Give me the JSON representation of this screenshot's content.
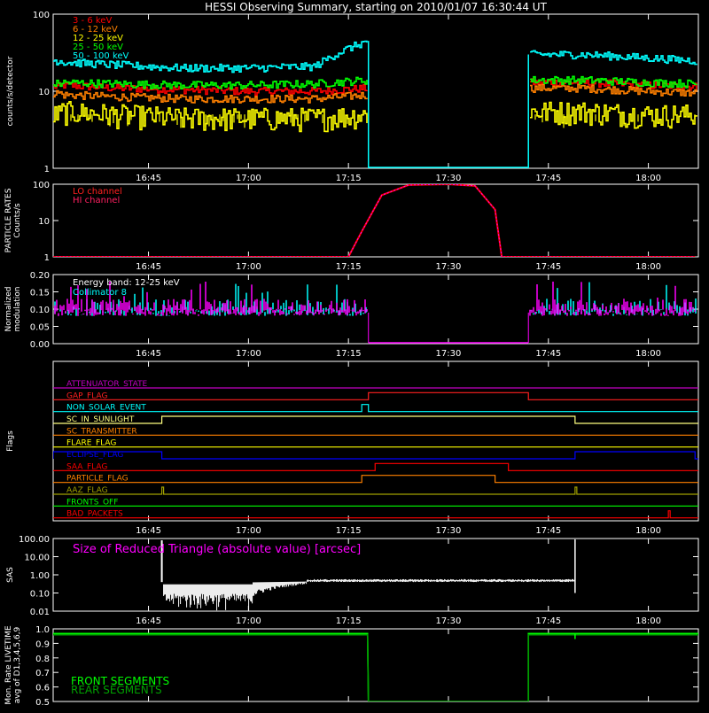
{
  "title": "HESSI Observing Summary, starting on 2010/01/07 16:30:44 UT",
  "time_ticks": [
    "16:45",
    "17:00",
    "17:15",
    "17:30",
    "17:45",
    "18:00"
  ],
  "chart_data": [
    {
      "id": "count-rates",
      "type": "line",
      "ylabel": "counts/s/detector",
      "yscale": "log",
      "ylim": [
        1,
        100
      ],
      "yticks": [
        "1",
        "10",
        "100"
      ],
      "legend_position": "top-left",
      "series": [
        {
          "name": "3 - 6 keV",
          "color": "#ff0000",
          "x": [
            "16:32",
            "16:40",
            "16:50",
            "17:00",
            "17:10",
            "17:18",
            "17:42",
            "17:50",
            "18:00",
            "18:07"
          ],
          "values": [
            12,
            11,
            10.5,
            10,
            10,
            11,
            null,
            13,
            12,
            11.5
          ]
        },
        {
          "name": "6 - 12 keV",
          "color": "#ff8000",
          "x": [
            "16:32",
            "16:40",
            "16:50",
            "17:00",
            "17:10",
            "17:18",
            "17:42",
            "17:50",
            "18:00",
            "18:07"
          ],
          "values": [
            9,
            8.5,
            8,
            8,
            8,
            9,
            null,
            11,
            10,
            9.5
          ]
        },
        {
          "name": "12 - 25 keV",
          "color": "#ffff00",
          "x": [
            "16:32",
            "16:40",
            "16:50",
            "17:00",
            "17:10",
            "17:18",
            "17:42",
            "17:50",
            "18:00",
            "18:07"
          ],
          "values": [
            5.5,
            5,
            4.5,
            4.5,
            4.5,
            5,
            null,
            5.5,
            5,
            5
          ]
        },
        {
          "name": "25 - 50 keV",
          "color": "#00ff00",
          "x": [
            "16:32",
            "16:40",
            "16:50",
            "17:00",
            "17:10",
            "17:18",
            "17:42",
            "17:50",
            "18:00",
            "18:07"
          ],
          "values": [
            13,
            12.5,
            12,
            12,
            12.5,
            14,
            null,
            14,
            13,
            12.5
          ]
        },
        {
          "name": "50 - 100 keV",
          "color": "#00ffff",
          "x": [
            "16:32",
            "16:40",
            "16:50",
            "17:00",
            "17:10",
            "17:18",
            "17:42",
            "17:50",
            "18:00",
            "18:07"
          ],
          "values": [
            24,
            22,
            20,
            20,
            21,
            45,
            null,
            30,
            27,
            25
          ]
        }
      ]
    },
    {
      "id": "particle-rates",
      "type": "line",
      "ylabel": "PARTICLE RATES Counts/s",
      "yscale": "log",
      "ylim": [
        1,
        100
      ],
      "yticks": [
        "1",
        "10",
        "100"
      ],
      "series": [
        {
          "name": "LO channel",
          "color": "#ff0000",
          "x": [
            "16:30",
            "17:15",
            "17:17",
            "17:20",
            "17:24",
            "17:30",
            "17:34",
            "17:37",
            "17:38",
            "18:07"
          ],
          "values": [
            1,
            1,
            5,
            50,
            95,
            100,
            90,
            20,
            1,
            1
          ]
        },
        {
          "name": "HI channel",
          "color": "#ff00ff",
          "x": [
            "16:30",
            "17:15",
            "17:17",
            "17:20",
            "17:24",
            "17:30",
            "17:34",
            "17:37",
            "17:38",
            "18:07"
          ],
          "values": [
            1,
            1,
            5,
            50,
            95,
            100,
            90,
            20,
            1,
            1
          ]
        }
      ]
    },
    {
      "id": "modulation",
      "type": "line",
      "ylabel": "Normalized modulation",
      "ylim": [
        0,
        0.2
      ],
      "yticks": [
        "0.00",
        "0.05",
        "0.10",
        "0.15",
        "0.20"
      ],
      "annotation": "Energy band: 12-25 keV",
      "series": [
        {
          "name": "Collimator 8",
          "color": "#00ffff",
          "x": [
            "16:30",
            "17:18",
            "17:42",
            "18:07"
          ],
          "values": [
            0.1,
            0.1,
            0.1,
            0.1
          ]
        },
        {
          "name": "",
          "color": "#ff00ff",
          "x": [
            "16:30",
            "17:18",
            "17:42",
            "18:07"
          ],
          "values": [
            0.1,
            0.1,
            0.1,
            0.1
          ]
        }
      ]
    },
    {
      "id": "flags",
      "type": "line",
      "ylabel": "Flags",
      "flags": [
        {
          "name": "ATTENUATOR_STATE",
          "color": "#c000c0",
          "high": []
        },
        {
          "name": "GAP_FLAG",
          "color": "#ff2020",
          "high": [
            [
              "17:18",
              "17:42"
            ]
          ]
        },
        {
          "name": "NON_SOLAR_EVENT",
          "color": "#00ffff",
          "high": [
            [
              "17:17",
              "17:18"
            ]
          ]
        },
        {
          "name": "SC_IN_SUNLIGHT",
          "color": "#ffff80",
          "high": [
            [
              "16:47",
              "17:49"
            ]
          ]
        },
        {
          "name": "SC_TRANSMITTER",
          "color": "#ff8000",
          "high": []
        },
        {
          "name": "FLARE_FLAG",
          "color": "#ffff00",
          "high": []
        },
        {
          "name": "ECLIPSE_FLAG",
          "color": "#0000ff",
          "high": [
            [
              "16:30",
              "16:47"
            ],
            [
              "17:49",
              "18:07"
            ]
          ]
        },
        {
          "name": "SAA_FLAG",
          "color": "#ff0000",
          "high": [
            [
              "17:19",
              "17:39"
            ]
          ]
        },
        {
          "name": "PARTICLE_FLAG",
          "color": "#ff8000",
          "high": [
            [
              "17:17",
              "17:37"
            ]
          ]
        },
        {
          "name": "AAZ_FLAG",
          "color": "#a0a000",
          "high": [
            [
              "16:47",
              "16:47"
            ],
            [
              "17:49",
              "17:49"
            ]
          ]
        },
        {
          "name": "FRONTS_OFF",
          "color": "#00ff00",
          "high": []
        },
        {
          "name": "BAD_PACKETS",
          "color": "#ff0000",
          "high": [
            [
              "18:03",
              "18:03"
            ]
          ]
        }
      ]
    },
    {
      "id": "sas",
      "type": "line",
      "ylabel": "SAS",
      "yscale": "log",
      "ylim": [
        0.01,
        100
      ],
      "yticks": [
        "0.01",
        "0.10",
        "1.00",
        "10.00",
        "100.00"
      ],
      "annotation": "Size of Reduced Triangle (absolute value) [arcsec]",
      "series": [
        {
          "name": "",
          "color": "#ffffff",
          "x": [
            "16:47",
            "16:50",
            "16:55",
            "17:00",
            "17:05",
            "17:10",
            "17:20",
            "17:30",
            "17:40",
            "17:49"
          ],
          "values": [
            50,
            0.3,
            0.25,
            0.2,
            0.3,
            0.4,
            0.5,
            0.55,
            0.55,
            0.6
          ]
        }
      ]
    },
    {
      "id": "livetime",
      "type": "line",
      "ylabel": "Mon. Rate LIVETIME avg of D1,3,4,5,6,9",
      "ylim": [
        0.5,
        1.0
      ],
      "yticks": [
        "0.5",
        "0.6",
        "0.7",
        "0.8",
        "0.9",
        "1.0"
      ],
      "series": [
        {
          "name": "FRONT SEGMENTS",
          "color": "#00ff00",
          "x": [
            "16:30",
            "17:17",
            "17:18",
            "17:42",
            "18:07"
          ],
          "values": [
            0.97,
            0.97,
            0.5,
            0.96,
            0.97
          ]
        },
        {
          "name": "REAR SEGMENTS",
          "color": "#00a000",
          "x": [
            "16:30",
            "17:17",
            "17:18",
            "17:42",
            "18:07"
          ],
          "values": [
            0.96,
            0.96,
            0.5,
            0.95,
            0.96
          ]
        }
      ]
    }
  ]
}
